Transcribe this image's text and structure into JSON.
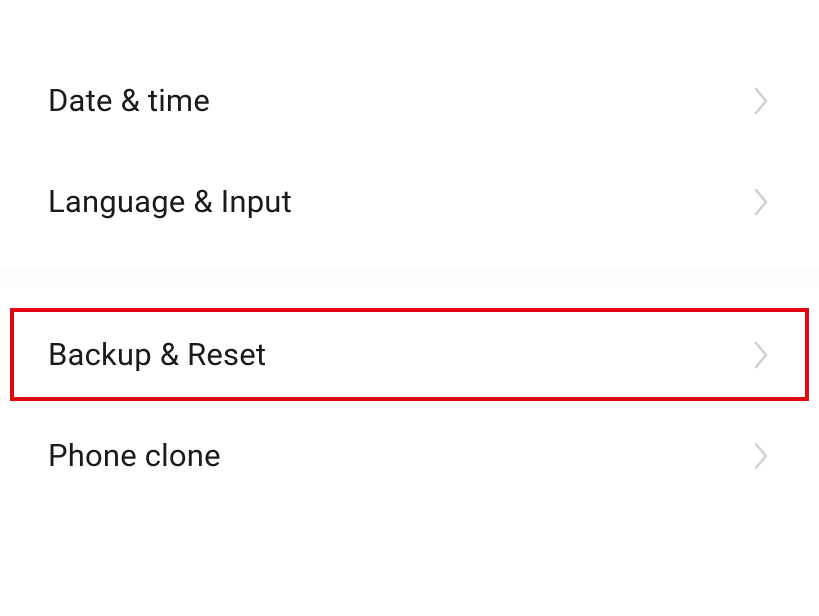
{
  "settings": {
    "group1": {
      "items": [
        {
          "label": "Date & time"
        },
        {
          "label": "Language & Input"
        }
      ]
    },
    "group2": {
      "items": [
        {
          "label": "Backup & Reset"
        },
        {
          "label": "Phone clone"
        }
      ]
    }
  },
  "highlight": {
    "color": "#e30613"
  }
}
